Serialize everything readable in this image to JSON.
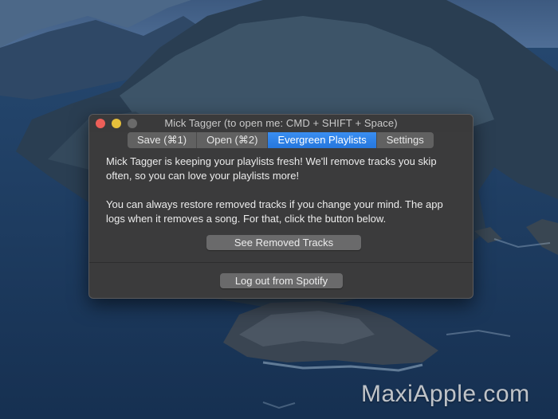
{
  "window": {
    "title": "Mick Tagger (to open me: CMD + SHIFT + Space)"
  },
  "tabs": [
    {
      "label": "Save (⌘1)",
      "active": false
    },
    {
      "label": "Open (⌘2)",
      "active": false
    },
    {
      "label": "Evergreen Playlists",
      "active": true
    },
    {
      "label": "Settings",
      "active": false
    }
  ],
  "content": {
    "paragraph1": "Mick Tagger is keeping your playlists fresh! We'll remove tracks you skip often, so you can love your playlists more!",
    "paragraph2": "You can always restore removed tracks if you change your mind. The app logs when it removes a song. For that, click the button below."
  },
  "buttons": {
    "see_removed": "See Removed Tracks",
    "logout": "Log out from Spotify"
  },
  "watermark": "MaxiApple.com",
  "colors": {
    "accent": "#2f85ec",
    "window_bg": "#3b3b3c",
    "close": "#ed5f58",
    "minimize": "#e5bf3b",
    "zoom": "#6a6a6a"
  }
}
